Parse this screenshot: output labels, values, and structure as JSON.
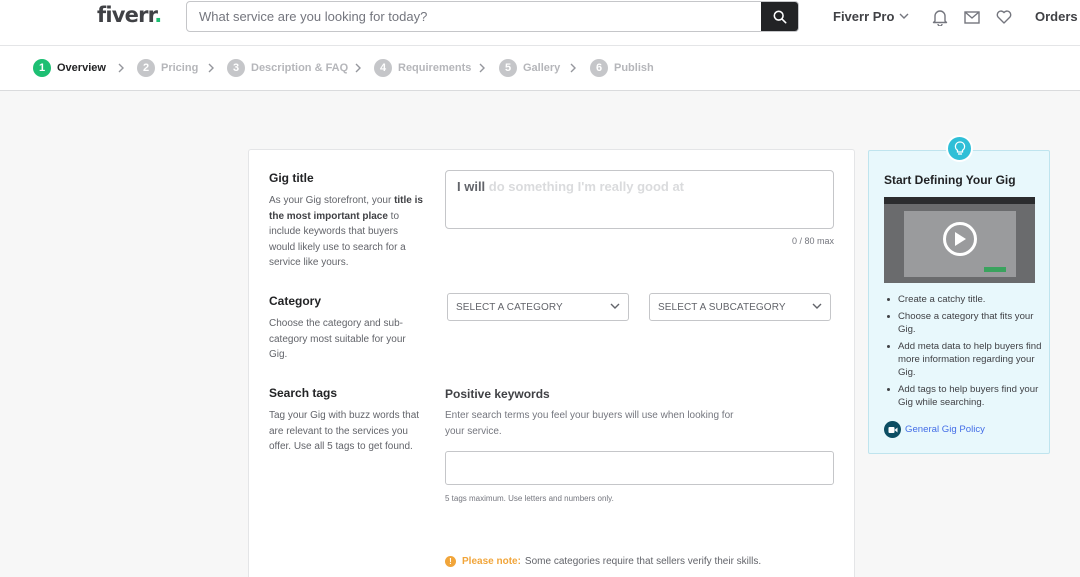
{
  "header": {
    "logo_text": "fiverr",
    "logo_dot": ".",
    "search_placeholder": "What service are you looking for today?",
    "pro_label": "Fiverr Pro",
    "orders_label": "Orders",
    "icons": [
      "search-icon",
      "chevron-down-icon",
      "bell-icon",
      "envelope-icon",
      "heart-icon"
    ]
  },
  "stepper": {
    "steps": [
      {
        "num": "1",
        "label": "Overview"
      },
      {
        "num": "2",
        "label": "Pricing"
      },
      {
        "num": "3",
        "label": "Description & FAQ"
      },
      {
        "num": "4",
        "label": "Requirements"
      },
      {
        "num": "5",
        "label": "Gallery"
      },
      {
        "num": "6",
        "label": "Publish"
      }
    ],
    "active_step": 1
  },
  "form": {
    "gig_title": {
      "label": "Gig title",
      "desc_1": "As your Gig storefront, your ",
      "desc_bold": "title is the most important place",
      "desc_2": " to include keywords that buyers would likely use to search for a service like yours.",
      "prefix": "I will",
      "placeholder": " do something I'm really good at",
      "counter": "0 / 80 max"
    },
    "category": {
      "label": "Category",
      "desc": "Choose the category and sub-category most suitable for your Gig.",
      "select_category": "SELECT A CATEGORY",
      "select_subcategory": "SELECT A SUBCATEGORY"
    },
    "search_tags": {
      "label": "Search tags",
      "desc": "Tag your Gig with buzz words that are relevant to the services you offer. Use all 5 tags to get found.",
      "keywords_title": "Positive keywords",
      "keywords_desc": "Enter search terms you feel your buyers will use when looking for your service.",
      "tags_value": "",
      "hint": "5 tags maximum. Use letters and numbers only."
    },
    "note": {
      "label": "Please note:",
      "text": "Some categories require that sellers verify their skills."
    }
  },
  "tip": {
    "title": "Start Defining Your Gig",
    "items": [
      "Create a catchy title.",
      "Choose a category that fits your Gig.",
      "Add meta data to help buyers find more information regarding your Gig.",
      "Add tags to help buyers find your Gig while searching."
    ],
    "policy_link": "General Gig Policy"
  },
  "colors": {
    "brand_green": "#1dbf73",
    "tip_accent": "#2fbfd7",
    "warning": "#f1a53a",
    "link": "#446ee7"
  }
}
